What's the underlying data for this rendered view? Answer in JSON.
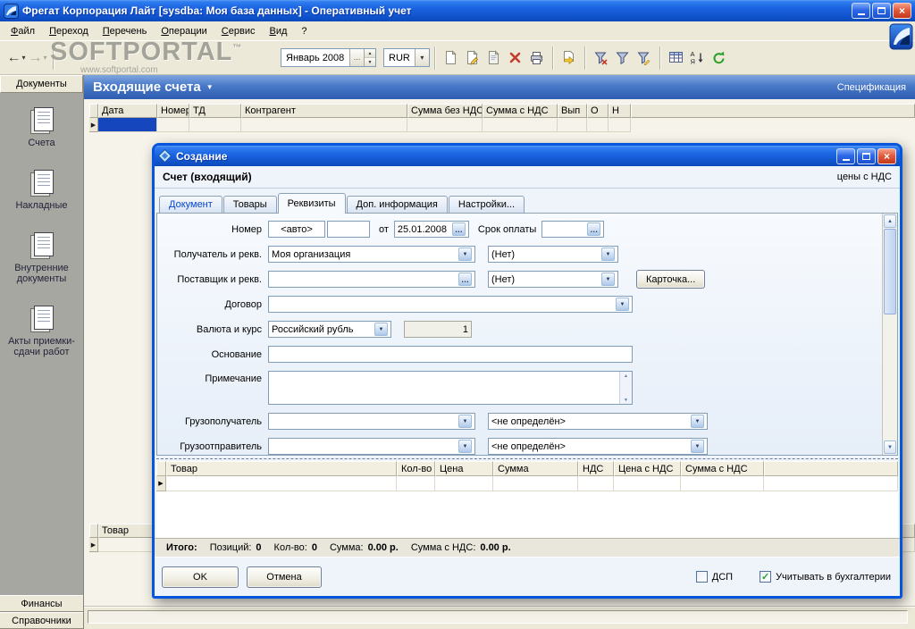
{
  "glyphs": {
    "back": "←",
    "forward": "→",
    "dropdown": "▼",
    "dropdown_small": "▾",
    "up": "▲",
    "down": "▼",
    "ellipsis": "…",
    "row_marker": "▶",
    "close": "×",
    "check": "✓"
  },
  "window": {
    "title": "Фрегат Корпорация Лайт [sysdba: Моя база данных] - Оперативный учет",
    "menu": [
      "Файл",
      "Переход",
      "Перечень",
      "Операции",
      "Сервис",
      "Вид",
      "?"
    ]
  },
  "toolbar": {
    "period": "Январь 2008",
    "currency": "RUR"
  },
  "watermark": {
    "title": "SOFTPORTAL",
    "tm": "™",
    "url": "www.softportal.com"
  },
  "sidebar": {
    "header": "Документы",
    "items": [
      "Счета",
      "Накладные",
      "Внутренние документы",
      "Акты приемки-сдачи работ"
    ],
    "footer": [
      "Финансы",
      "Справочники"
    ]
  },
  "main": {
    "header": {
      "title": "Входящие счета",
      "spec": "Спецификация"
    },
    "table": {
      "columns": [
        "Дата",
        "Номер",
        "ТД",
        "Контрагент",
        "Сумма без НДС",
        "Сумма с НДС",
        "Вып",
        "О",
        "Н"
      ]
    },
    "lower": {
      "columns": [
        "Товар"
      ]
    }
  },
  "dialog": {
    "title": "Создание",
    "doc_type": "Счет (входящий)",
    "price_note": "цены с НДС",
    "tabs": [
      "Документ",
      "Товары",
      "Реквизиты",
      "Доп. информация",
      "Настройки..."
    ],
    "form": {
      "number_label": "Номер",
      "number_value": "<авто>",
      "number2_value": "",
      "from_label": "от",
      "date_value": "25.01.2008",
      "due_label": "Срок оплаты",
      "due_value": "",
      "receiver_label": "Получатель и рекв.",
      "receiver_value": "Моя организация",
      "receiver_req_value": "(Нет)",
      "supplier_label": "Поставщик и рекв.",
      "supplier_value": "",
      "supplier_req_value": "(Нет)",
      "card_button": "Карточка...",
      "contract_label": "Договор",
      "contract_value": "",
      "currency_label": "Валюта и курс",
      "currency_value": "Российский рубль",
      "rate_value": "1",
      "basis_label": "Основание",
      "basis_value": "",
      "note_label": "Примечание",
      "note_value": "",
      "consignee_label": "Грузополучатель",
      "consignee_value": "",
      "consignee_req_value": "<не определён>",
      "shipper_label": "Грузоотправитель",
      "shipper_value": "",
      "shipper_req_value": "<не определён>"
    },
    "items": {
      "columns": [
        "Товар",
        "Кол-во",
        "Цена",
        "Сумма",
        "НДС",
        "Цена с НДС",
        "Сумма с НДС"
      ]
    },
    "totals": {
      "label": "Итого:",
      "positions_label": "Позиций:",
      "positions_value": "0",
      "qty_label": "Кол-во:",
      "qty_value": "0",
      "sum_label": "Сумма:",
      "sum_value": "0.00 р.",
      "sum_vat_label": "Сумма с НДС:",
      "sum_vat_value": "0.00 р."
    },
    "buttons": {
      "ok": "OK",
      "cancel": "Отмена"
    },
    "checks": {
      "dsp": "ДСП",
      "accounting": "Учитывать в бухгалтерии"
    }
  }
}
